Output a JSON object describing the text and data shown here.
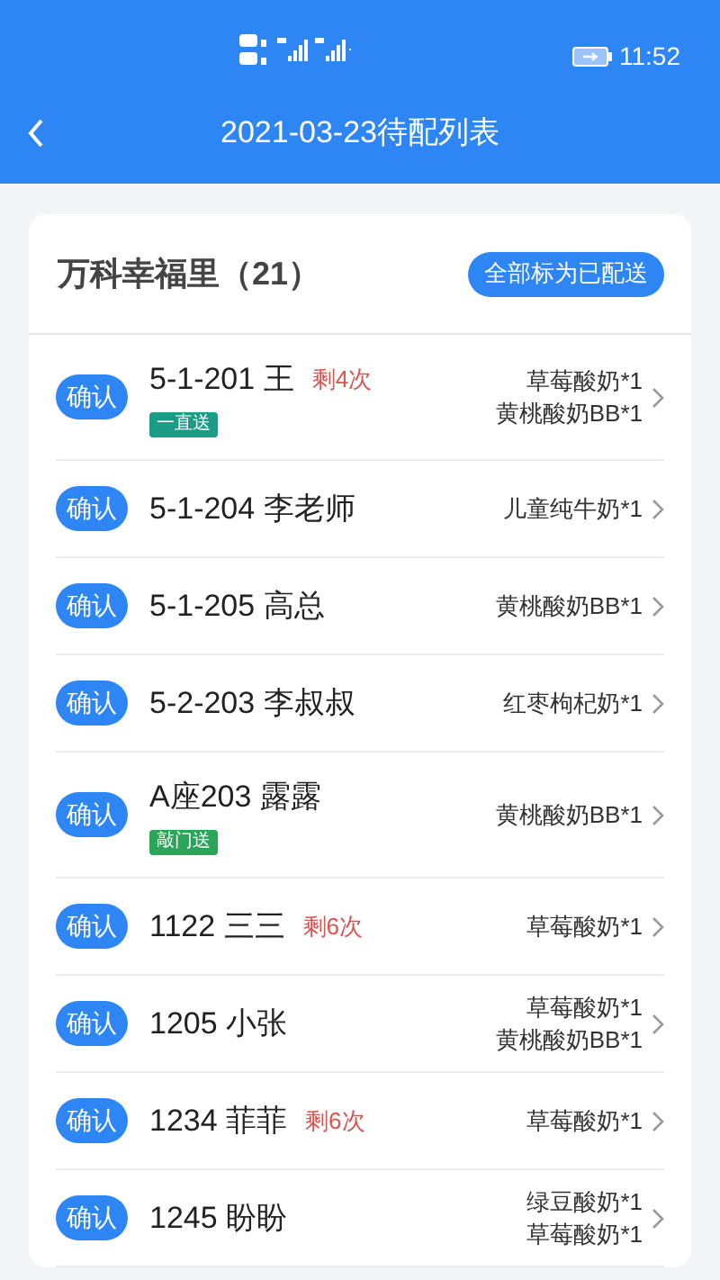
{
  "status_bar": {
    "time": "11:52"
  },
  "header": {
    "title": "2021-03-23待配列表"
  },
  "group": {
    "title": "万科幸福里（21）",
    "action": "全部标为已配送"
  },
  "rows": [
    {
      "confirm": "确认",
      "address": "5-1-201 王",
      "remaining": "剩4次",
      "tag": {
        "label": "一直送",
        "color": "#1a9c86"
      },
      "items": [
        "草莓酸奶*1",
        "黄桃酸奶BB*1"
      ]
    },
    {
      "confirm": "确认",
      "address": "5-1-204 李老师",
      "items": [
        "儿童纯牛奶*1"
      ]
    },
    {
      "confirm": "确认",
      "address": "5-1-205 高总",
      "items": [
        "黄桃酸奶BB*1"
      ]
    },
    {
      "confirm": "确认",
      "address": "5-2-203 李叔叔",
      "items": [
        "红枣枸杞奶*1"
      ]
    },
    {
      "confirm": "确认",
      "address": "A座203 露露",
      "tag": {
        "label": "敲门送",
        "color": "#2aa55a"
      },
      "items": [
        "黄桃酸奶BB*1"
      ]
    },
    {
      "confirm": "确认",
      "address": "1122 三三",
      "remaining": "剩6次",
      "items": [
        "草莓酸奶*1"
      ]
    },
    {
      "confirm": "确认",
      "address": "1205 小张",
      "items": [
        "草莓酸奶*1",
        "黄桃酸奶BB*1"
      ]
    },
    {
      "confirm": "确认",
      "address": "1234 菲菲",
      "remaining": "剩6次",
      "items": [
        "草莓酸奶*1"
      ]
    },
    {
      "confirm": "确认",
      "address": "1245 盼盼",
      "items": [
        "绿豆酸奶*1",
        "草莓酸奶*1"
      ]
    }
  ]
}
